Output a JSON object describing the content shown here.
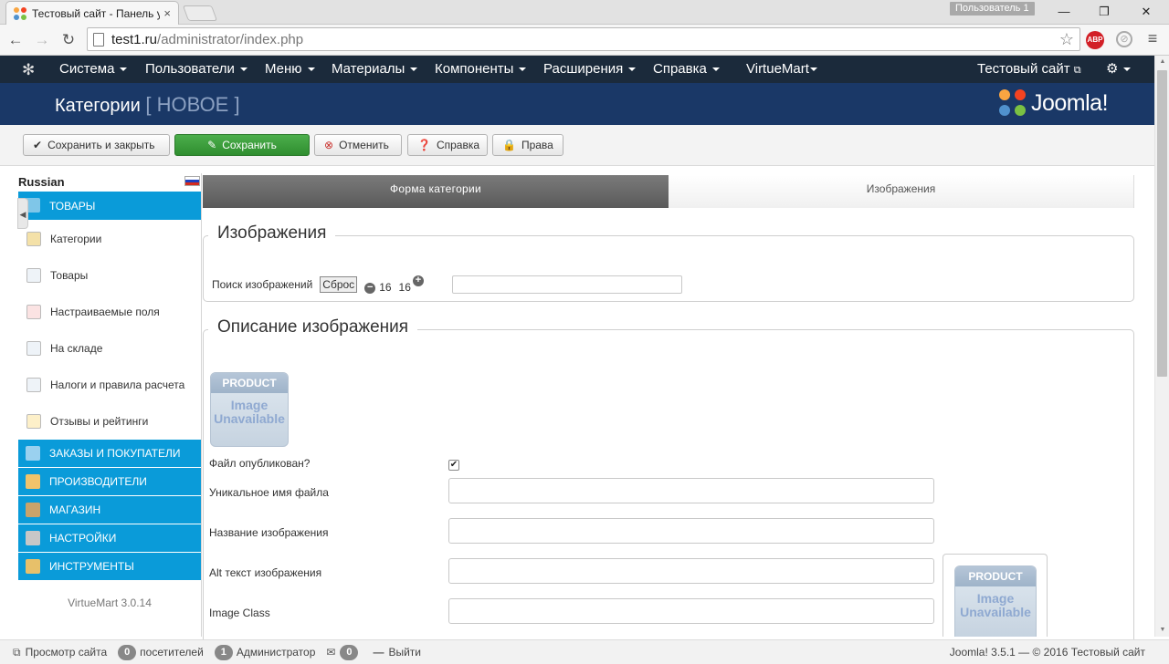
{
  "browser": {
    "tab_title": "Тестовый сайт - Панель у",
    "tab_close": "×",
    "user_badge": "Пользователь 1",
    "url_host": "test1.ru",
    "url_path": "/administrator/index.php",
    "abp_label": "ABP",
    "win_min": "—",
    "win_max": "❐",
    "win_close": "✕"
  },
  "topnav": {
    "items": [
      {
        "label": "Система"
      },
      {
        "label": "Пользователи"
      },
      {
        "label": "Меню"
      },
      {
        "label": "Материалы"
      },
      {
        "label": "Компоненты"
      },
      {
        "label": "Расширения"
      },
      {
        "label": "Справка"
      },
      {
        "label": "VirtueMart"
      }
    ],
    "site_link": "Тестовый сайт"
  },
  "header": {
    "title": "Категории",
    "subtitle": "[ НОВОЕ ]",
    "logo_text": "Joomla!"
  },
  "toolbar": {
    "save_close": "Сохранить и закрыть",
    "save": "Сохранить",
    "cancel": "Отменить",
    "help": "Справка",
    "rights": "Права"
  },
  "sidebar": {
    "language": "Russian",
    "sections": [
      {
        "label": "ТОВАРЫ"
      },
      {
        "label": "ЗАКАЗЫ И ПОКУПАТЕЛИ"
      },
      {
        "label": "ПРОИЗВОДИТЕЛИ"
      },
      {
        "label": "МАГАЗИН"
      },
      {
        "label": "НАСТРОЙКИ"
      },
      {
        "label": "ИНСТРУМЕНТЫ"
      }
    ],
    "items": [
      {
        "label": "Категории"
      },
      {
        "label": "Товары"
      },
      {
        "label": "Настраиваемые поля"
      },
      {
        "label": "На складе"
      },
      {
        "label": "Налоги и правила расчета"
      },
      {
        "label": "Отзывы и рейтинги"
      }
    ],
    "version": "VirtueMart 3.0.14"
  },
  "tabs": [
    {
      "label": "Форма категории"
    },
    {
      "label": "Изображения"
    }
  ],
  "images": {
    "legend": "Изображения",
    "search_label": "Поиск изображений",
    "reset_button": "Сброс",
    "zoom_out_value": "16",
    "zoom_in_value": "16"
  },
  "description": {
    "legend": "Описание изображения",
    "placeholder_top": "PRODUCT",
    "placeholder_line1": "Image",
    "placeholder_line2": "Unavailable",
    "published_label": "Файл опубликован?",
    "unique_name_label": "Уникальное имя файла",
    "image_title_label": "Название изображения",
    "alt_label": "Alt текст изображения",
    "class_label": "Image Class"
  },
  "status": {
    "view_site": "Просмотр сайта",
    "visitors_count": "0",
    "visitors_label": "посетителей",
    "admins_count": "1",
    "admins_label": "Администратор",
    "messages_count": "0",
    "logout": "Выйти",
    "copyright": "Joomla! 3.5.1 — © 2016 Тестовый сайт"
  }
}
